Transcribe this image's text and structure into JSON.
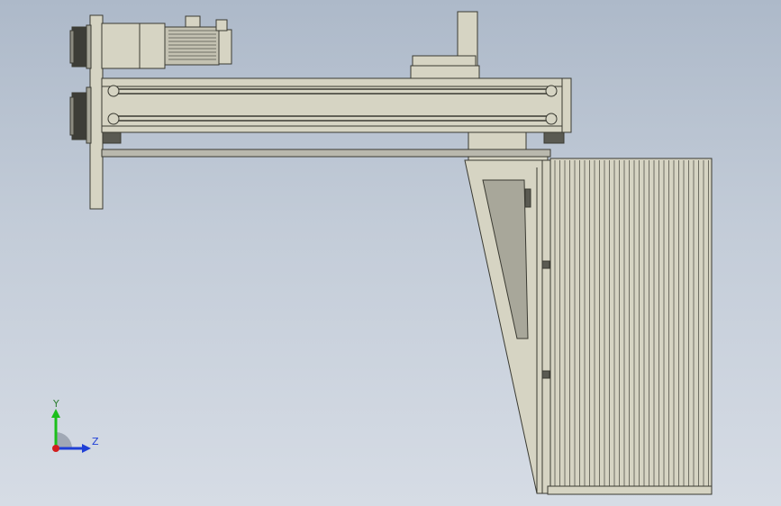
{
  "viewport": {
    "name": "cad-model-side-view"
  },
  "triad": {
    "y_label": "Y",
    "z_label": "Z",
    "colors": {
      "y": "#1bbf1b",
      "z": "#1f3fd6",
      "x": "#d21e1e"
    }
  },
  "colors": {
    "part_fill": "#d6d4c3",
    "part_stroke": "#3a3a32",
    "dark_part": "#5a5a52",
    "rod": "#b9b8ad"
  }
}
